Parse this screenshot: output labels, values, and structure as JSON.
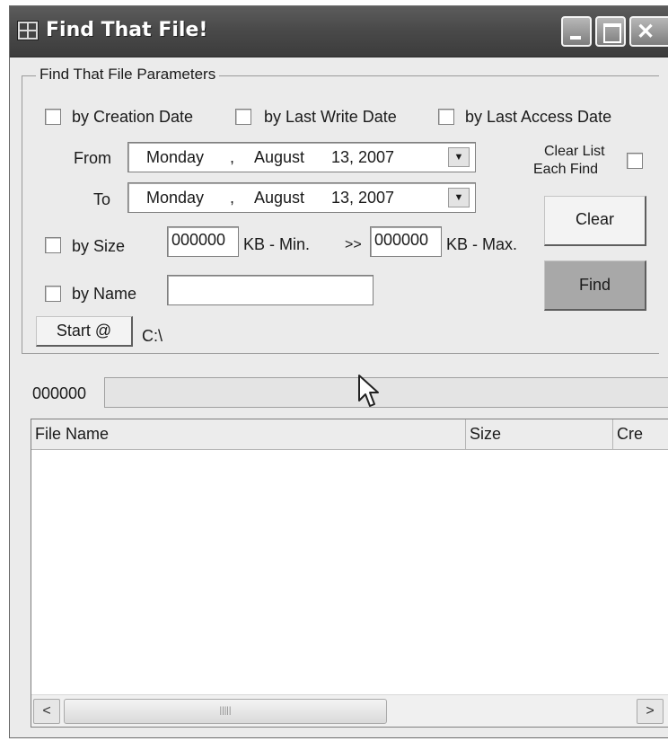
{
  "window": {
    "title": "Find That File!"
  },
  "group": {
    "legend": "Find That File Parameters",
    "by_creation_date": "by Creation Date",
    "by_last_write_date": "by Last Write Date",
    "by_last_access_date": "by Last Access Date",
    "from_label": "From",
    "to_label": "To",
    "from_date": {
      "weekday": "Monday",
      "sep": ",",
      "month": "August",
      "day_year": "13, 2007"
    },
    "to_date": {
      "weekday": "Monday",
      "sep": ",",
      "month": "August",
      "day_year": "13, 2007"
    },
    "clear_list_line1": "Clear List",
    "clear_list_line2": "Each Find",
    "clear_button": "Clear",
    "find_button": "Find",
    "by_size": "by Size",
    "min_value": "000000",
    "min_unit": "KB - Min.",
    "arrow": ">>",
    "max_value": "000000",
    "max_unit": "KB - Max.",
    "by_name": "by Name",
    "name_value": "",
    "start_button": "Start @",
    "start_path": "C:\\"
  },
  "status": {
    "count": "000000",
    "progress": 0
  },
  "list": {
    "columns": [
      "File Name",
      "Size",
      "Cre"
    ]
  },
  "icons": {
    "window_icon": "app-window-icon",
    "minimize": "minimize-icon",
    "maximize": "maximize-icon",
    "close": "close-icon",
    "dropdown": "chevron-down-icon",
    "scroll_left": "scroll-left-icon",
    "scroll_right": "scroll-right-icon"
  },
  "colors": {
    "titlebar": "#4a4a4a",
    "find_button": "#a8a8a8",
    "window_bg": "#ebebeb"
  }
}
